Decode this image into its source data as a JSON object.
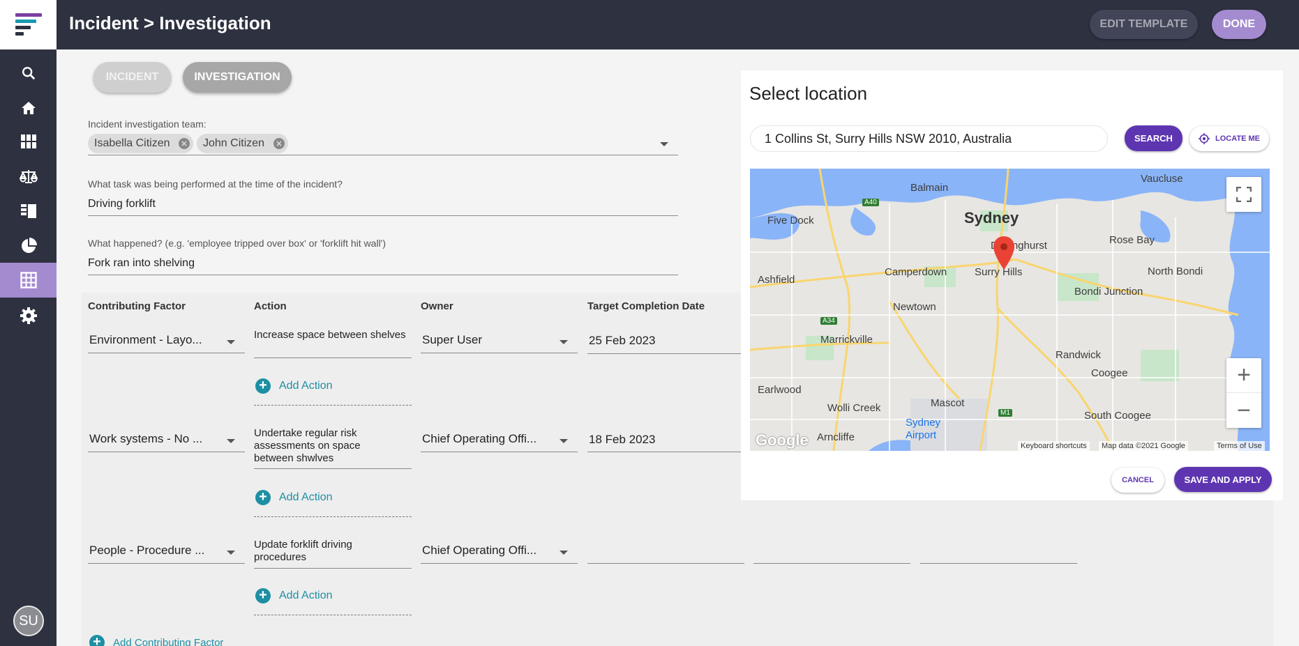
{
  "header": {
    "title": "Incident > Investigation",
    "edit_template_label": "EDIT TEMPLATE",
    "done_label": "DONE"
  },
  "sidebar": {
    "items": [
      {
        "icon": "search-icon"
      },
      {
        "icon": "home-icon"
      },
      {
        "icon": "grid-icon"
      },
      {
        "icon": "scales-icon"
      },
      {
        "icon": "list-icon"
      },
      {
        "icon": "pie-chart-icon"
      },
      {
        "icon": "table-icon",
        "active": true
      },
      {
        "icon": "gear-icon"
      }
    ],
    "avatar_initials": "SU"
  },
  "tabs": [
    {
      "label": "INCIDENT"
    },
    {
      "label": "INVESTIGATION"
    }
  ],
  "form": {
    "team_label": "Incident investigation team:",
    "team_members": [
      "Isabella Citizen",
      "John Citizen"
    ],
    "task_label": "What task was being performed at the time of the incident?",
    "task_value": "Driving forklift",
    "happened_label": "What happened? (e.g. 'employee tripped over box' or 'forklift hit wall')",
    "happened_value": "Fork ran into shelving"
  },
  "table": {
    "headers": [
      "Contributing Factor",
      "Action",
      "Owner",
      "Target Completion Date"
    ],
    "rows": [
      {
        "factor": "Environment - Layo...",
        "action": "Increase space between shelves",
        "owner": "Super User",
        "date": "25 Feb 2023"
      },
      {
        "factor": "Work systems - No ...",
        "action": "Undertake regular risk assessments on space between shwlves",
        "owner": "Chief Operating Offi...",
        "date": "18 Feb 2023"
      },
      {
        "factor": "People - Procedure ...",
        "action": "Update forklift driving procedures",
        "owner": "Chief Operating Offi...",
        "date": ""
      }
    ],
    "add_action_label": "Add Action",
    "add_factor_label": "Add Contributing Factor"
  },
  "location_modal": {
    "title": "Select location",
    "address_value": "1 Collins St, Surry Hills NSW 2010, Australia",
    "search_label": "SEARCH",
    "locate_me_label": "LOCATE ME",
    "cancel_label": "CANCEL",
    "save_label": "SAVE AND APPLY",
    "map": {
      "labels": [
        "Balmain",
        "Vaucluse",
        "Five Dock",
        "Sydney",
        "Darlinghurst",
        "Rose Bay",
        "Camperdown",
        "Surry Hills",
        "North Bondi",
        "Ashfield",
        "Bondi Junction",
        "Newtown",
        "Marrickville",
        "Randwick",
        "Coogee",
        "Earlwood",
        "Mascot",
        "Wolli Creek",
        "Sydney Airport",
        "South Coogee",
        "Arncliffe"
      ],
      "road_badges": [
        "A40",
        "A34",
        "M1"
      ],
      "google_logo": "Google",
      "footer": [
        "Keyboard shortcuts",
        "Map data ©2021 Google",
        "Terms of Use"
      ]
    }
  },
  "colors": {
    "dark": "#2e3140",
    "accent": "#a48bd0",
    "primary": "#5e35b1",
    "link": "#1d8fa3"
  }
}
